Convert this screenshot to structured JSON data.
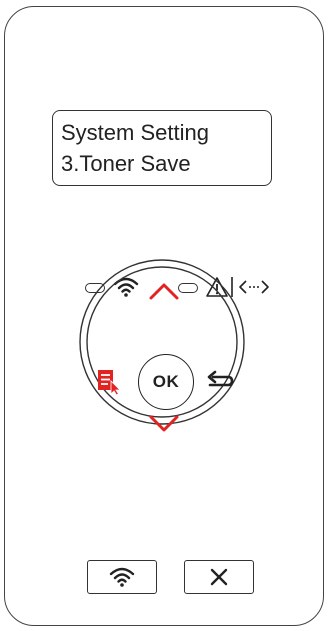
{
  "display": {
    "line1": "System Setting",
    "line2": "3.Toner Save"
  },
  "indicators": [
    {
      "name": "wifi-led",
      "icon": "wifi-icon"
    },
    {
      "name": "error-led",
      "icon": "warning-icon",
      "secondary_icon": "data-transfer-icon"
    }
  ],
  "dpad": {
    "up": "chevron-up-icon",
    "down": "chevron-down-icon",
    "left": "menu-icon",
    "right": "back-icon",
    "center_label": "OK"
  },
  "buttons": [
    {
      "name": "wifi-button",
      "icon": "wifi-icon"
    },
    {
      "name": "cancel-button",
      "icon": "close-icon"
    }
  ],
  "colors": {
    "accent": "#e32222",
    "outline": "#333333"
  }
}
